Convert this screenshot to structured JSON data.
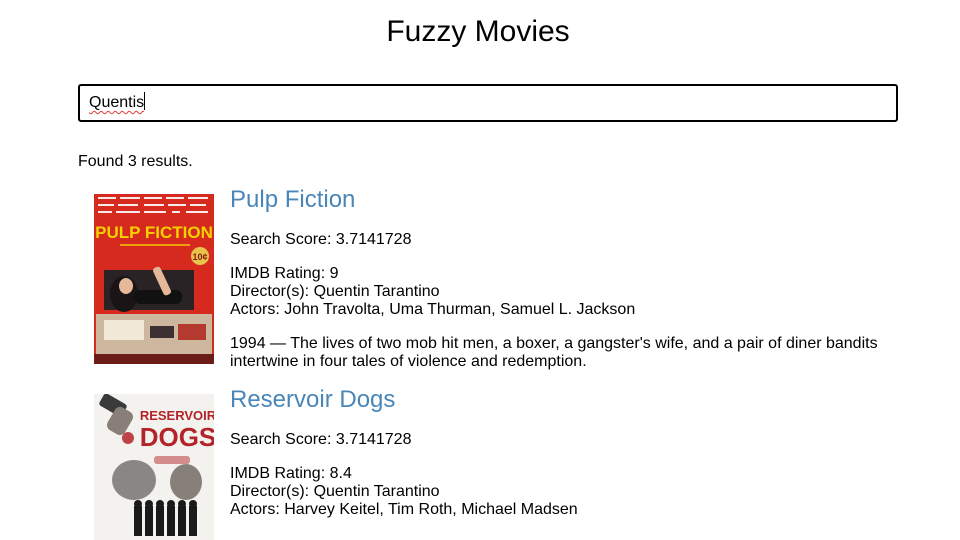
{
  "header": {
    "title": "Fuzzy Movies"
  },
  "search": {
    "value": "Quentis"
  },
  "results_text": "Found 3 results.",
  "results": [
    {
      "title": "Pulp Fiction",
      "score_label": "Search Score:",
      "score": "3.7141728",
      "rating_label": "IMDB Rating:",
      "rating": "9",
      "directors_label": "Director(s):",
      "directors": "Quentin Tarantino",
      "actors_label": "Actors:",
      "actors": "John Travolta, Uma Thurman, Samuel L. Jackson",
      "year": "1994",
      "separator": "—",
      "plot": "The lives of two mob hit men, a boxer, a gangster's wife, and a pair of diner bandits intertwine in four tales of violence and redemption.",
      "poster": {
        "title_text": "PULP FICTION",
        "badge": "10¢",
        "colors": {
          "bg": "#d62a1e",
          "title": "#f4d100"
        }
      }
    },
    {
      "title": "Reservoir Dogs",
      "score_label": "Search Score:",
      "score": "3.7141728",
      "rating_label": "IMDB Rating:",
      "rating": "8.4",
      "directors_label": "Director(s):",
      "directors": "Quentin Tarantino",
      "actors_label": "Actors:",
      "actors": "Harvey Keitel, Tim Roth, Michael Madsen",
      "poster": {
        "title_line1": "RESERVOIR",
        "title_line2": "DOGS",
        "colors": {
          "bg": "#f4f2ee",
          "title": "#b3242a"
        }
      }
    }
  ],
  "colors": {
    "link": "#4a86b8",
    "text": "#000000",
    "border": "#000000",
    "spellcheck": "#e53935"
  }
}
